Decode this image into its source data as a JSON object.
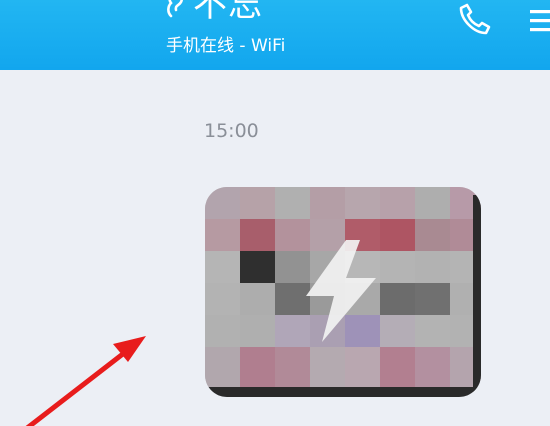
{
  "header": {
    "contact_name": "不忘",
    "status": "手机在线 - WiFi",
    "icons": [
      "ear-icon",
      "phone-icon",
      "menu-icon"
    ],
    "bar_color": "#1aaef0"
  },
  "chat": {
    "timestamp": "15:00",
    "message": {
      "type": "image",
      "icon": "flash-icon"
    }
  },
  "annotation": {
    "color": "#e81c1c",
    "icon": "red-arrow"
  }
}
